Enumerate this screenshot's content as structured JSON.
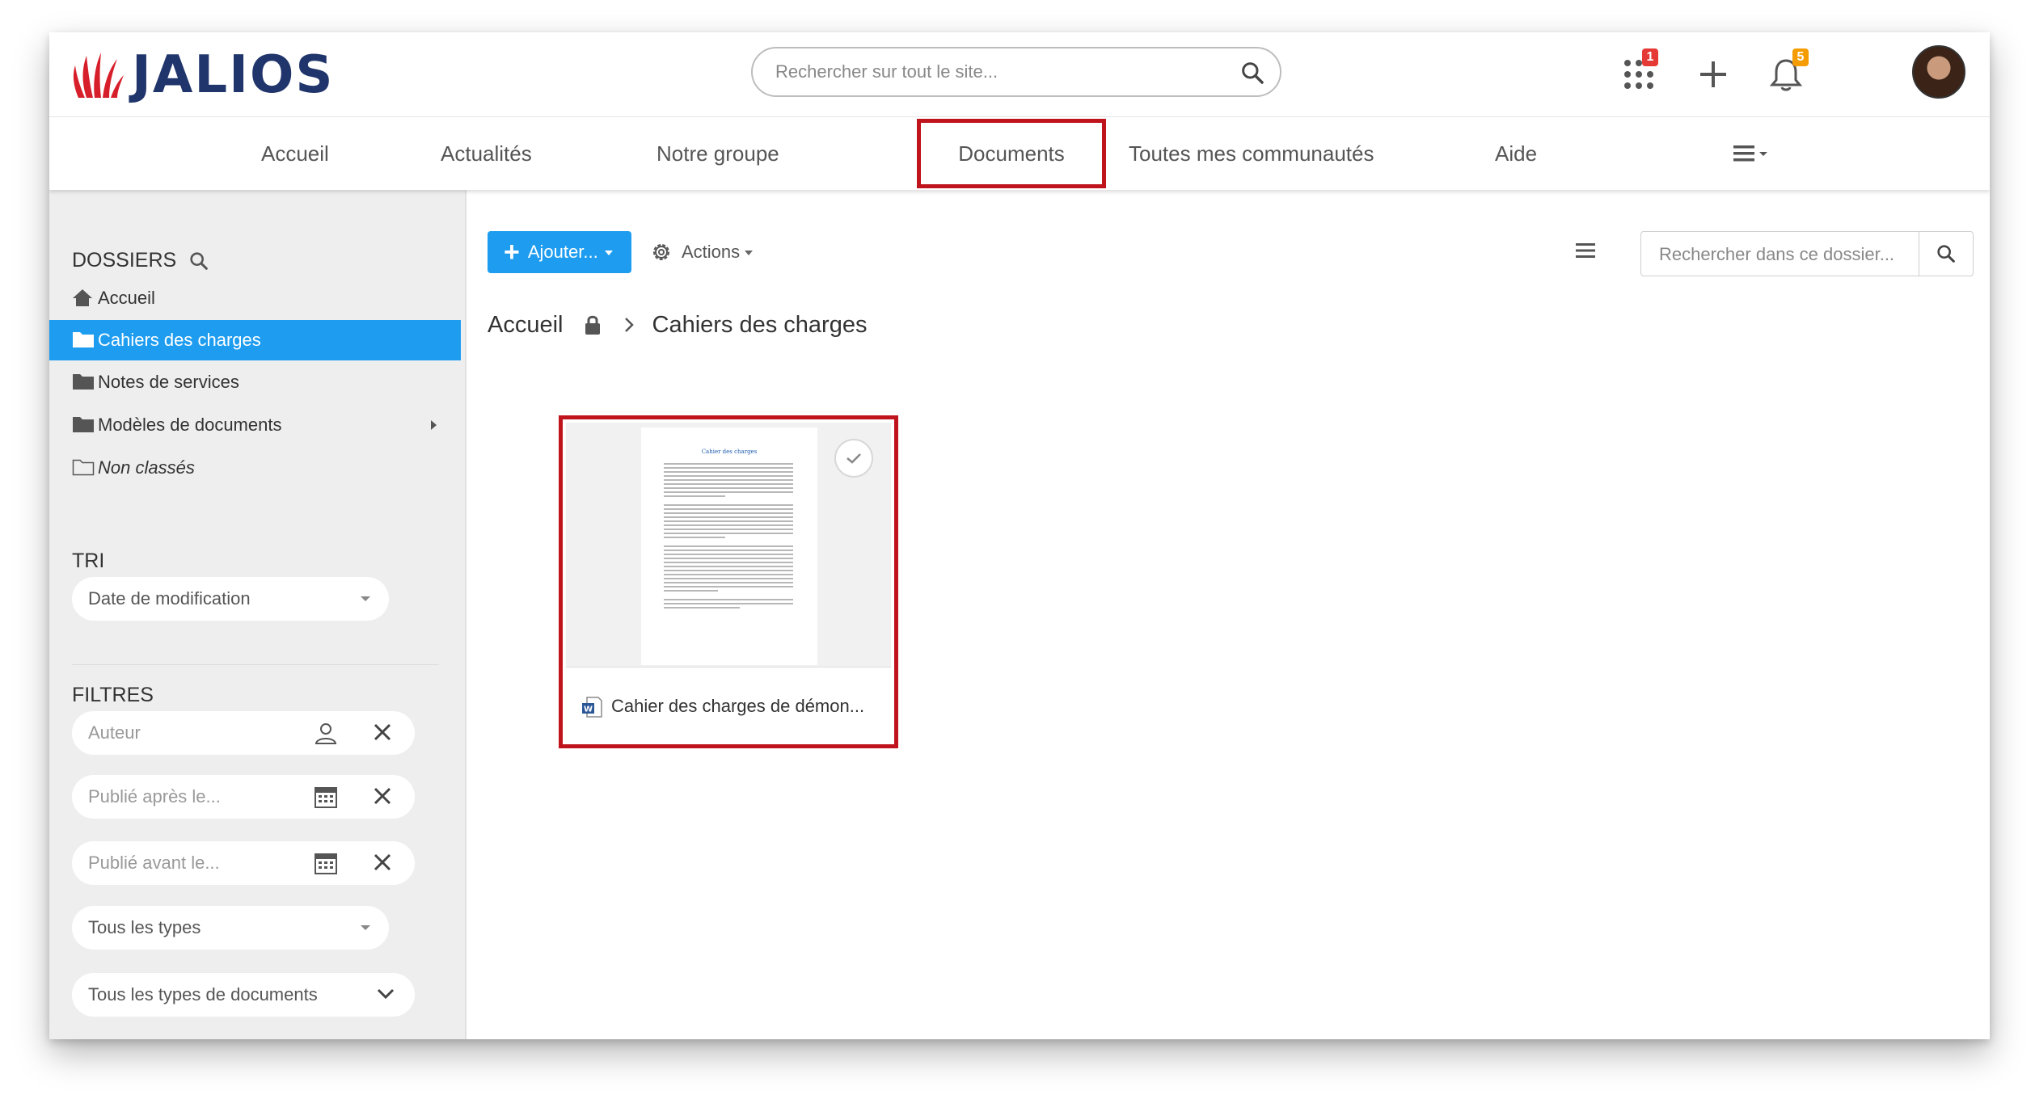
{
  "header": {
    "logo_text": "JALIOS",
    "search_placeholder": "Rechercher sur tout le site...",
    "apps_badge": "1",
    "notifications_badge": "5",
    "colors": {
      "logo_red": "#d71f2b",
      "logo_navy": "#20356b",
      "badge_red": "#e53935",
      "badge_orange": "#f59c00"
    }
  },
  "nav": {
    "items": [
      {
        "label": "Accueil"
      },
      {
        "label": "Actualités"
      },
      {
        "label": "Notre groupe"
      },
      {
        "label": "Documents",
        "highlighted": true
      },
      {
        "label": "Toutes mes communautés"
      },
      {
        "label": "Aide"
      }
    ],
    "more_icon": "hamburger-menu-icon"
  },
  "sidebar": {
    "folders_title": "DOSSIERS",
    "folders": [
      {
        "label": "Accueil",
        "icon": "home-icon"
      },
      {
        "label": "Cahiers des charges",
        "icon": "folder-icon",
        "active": true
      },
      {
        "label": "Notes de services",
        "icon": "folder-icon"
      },
      {
        "label": "Modèles de documents",
        "icon": "folder-icon",
        "has_children": true
      },
      {
        "label": "Non classés",
        "icon": "folder-outline-icon"
      }
    ],
    "sort_title": "TRI",
    "sort_value": "Date de modification",
    "filters_title": "FILTRES",
    "filters": {
      "author_placeholder": "Auteur",
      "published_after_placeholder": "Publié après le...",
      "published_before_placeholder": "Publié avant le...",
      "types_value": "Tous les types",
      "document_types_value": "Tous les types de documents"
    },
    "accent_color": "#1e9cf0"
  },
  "main": {
    "add_button_label": "Ajouter...",
    "actions_label": "Actions",
    "folder_search_placeholder": "Rechercher dans ce dossier...",
    "breadcrumb": {
      "root": "Accueil",
      "current": "Cahiers des charges"
    },
    "document": {
      "name": "Cahier des charges de démon...",
      "preview_title": "Cahier des charges",
      "type_icon": "word-document-icon"
    },
    "highlight_color": "#c0141d"
  }
}
